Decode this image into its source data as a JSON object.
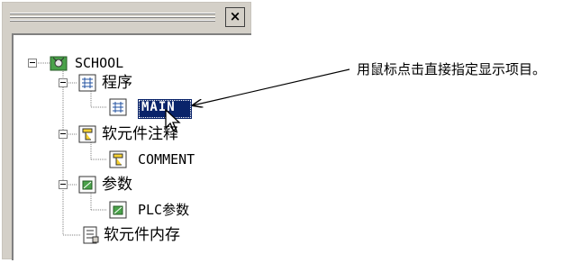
{
  "window": {
    "close_label": "×"
  },
  "tree": {
    "root": {
      "label": "SCHOOL",
      "icon": "project-icon"
    },
    "program": {
      "label": "程序",
      "icon": "program-folder-icon",
      "children": [
        {
          "label": "MAIN",
          "icon": "program-icon",
          "selected": true
        }
      ]
    },
    "device_comment": {
      "label": "软元件注释",
      "icon": "comment-folder-icon",
      "children": [
        {
          "label": "COMMENT",
          "icon": "comment-icon"
        }
      ]
    },
    "parameter": {
      "label": "参数",
      "icon": "parameter-folder-icon",
      "children": [
        {
          "label": "PLC参数",
          "icon": "parameter-icon"
        }
      ]
    },
    "device_memory": {
      "label": "软元件内存",
      "icon": "memory-icon"
    }
  },
  "callout": {
    "text": "用鼠标点击直接指定显示项目。"
  },
  "colors": {
    "selection": "#0a246a",
    "panel": "#d4d0c8",
    "tree_bg": "#ffffff"
  }
}
